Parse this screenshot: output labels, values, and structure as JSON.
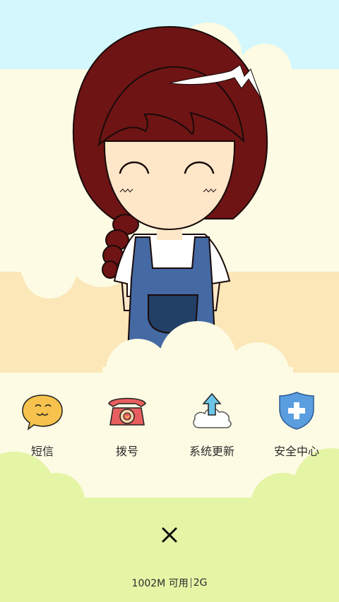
{
  "apps": [
    {
      "label": "短信",
      "icon": "sms-bubble-icon"
    },
    {
      "label": "拨号",
      "icon": "phone-dial-icon"
    },
    {
      "label": "系统更新",
      "icon": "cloud-upload-icon"
    },
    {
      "label": "安全中心",
      "icon": "security-shield-icon"
    }
  ],
  "close": {
    "icon": "close-icon"
  },
  "status": {
    "memory": "1002M 可用",
    "network": "2G"
  },
  "colors": {
    "sky": "#d3f7fc",
    "cream": "#fdfbe3",
    "sand": "#fbe7b8",
    "grass": "#e4f5a6",
    "hair": "#6e1414",
    "overalls": "#4469a3"
  }
}
